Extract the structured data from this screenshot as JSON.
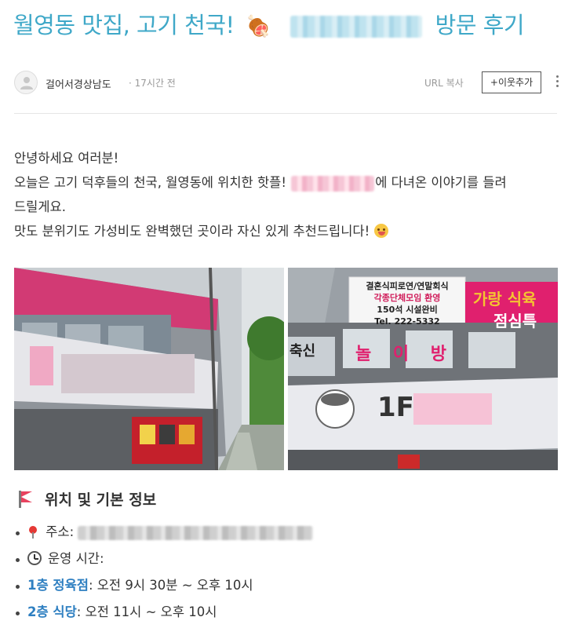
{
  "post": {
    "title_prefix": "월영동 맛집, 고기 천국!",
    "title_emoji": "🍖",
    "title_suffix": "방문 후기",
    "author": "걸어서경상남도",
    "time": "· 17시간 전",
    "url_copy": "URL 복사",
    "follow": "+이웃추가"
  },
  "body": {
    "line1": "안녕하세요 여러분!",
    "line2a": "오늘은 고기 덕후들의 천국, 월영동에 위치한 핫플!",
    "line2b": "에 다녀온 이야기를 들려",
    "line3": "드릴게요.",
    "line4": "맛도 분위기도 가성비도 완벽했던 곳이라 자신 있게 추천드립니다!"
  },
  "photos": {
    "p2_sign_line1": "결혼식피로연/연말회식",
    "p2_sign_line2": "각종단체모임 환영",
    "p2_sign_line3": "150석 시설완비",
    "p2_sign_line4": "Tel. 222-5332",
    "p2_shop_name": "가랑 식육",
    "p2_lunch": "점심특",
    "p2_play": "놀 이 방",
    "p2_floor": "1F",
    "p2_left": "축신"
  },
  "section": {
    "title": "위치 및 기본 정보",
    "address_label": "주소:",
    "hours_label": "운영 시간:",
    "floor1_label": "1층 정육점",
    "floor1_hours": ": 오전 9시 30분 ~ 오후 10시",
    "floor2_label": "2층 식당",
    "floor2_hours": ": 오전 11시 ~ 오후 10시"
  },
  "colors": {
    "title": "#3fa8c8",
    "link_blue": "#2e7fc1",
    "sign_pink": "#e0206e"
  }
}
